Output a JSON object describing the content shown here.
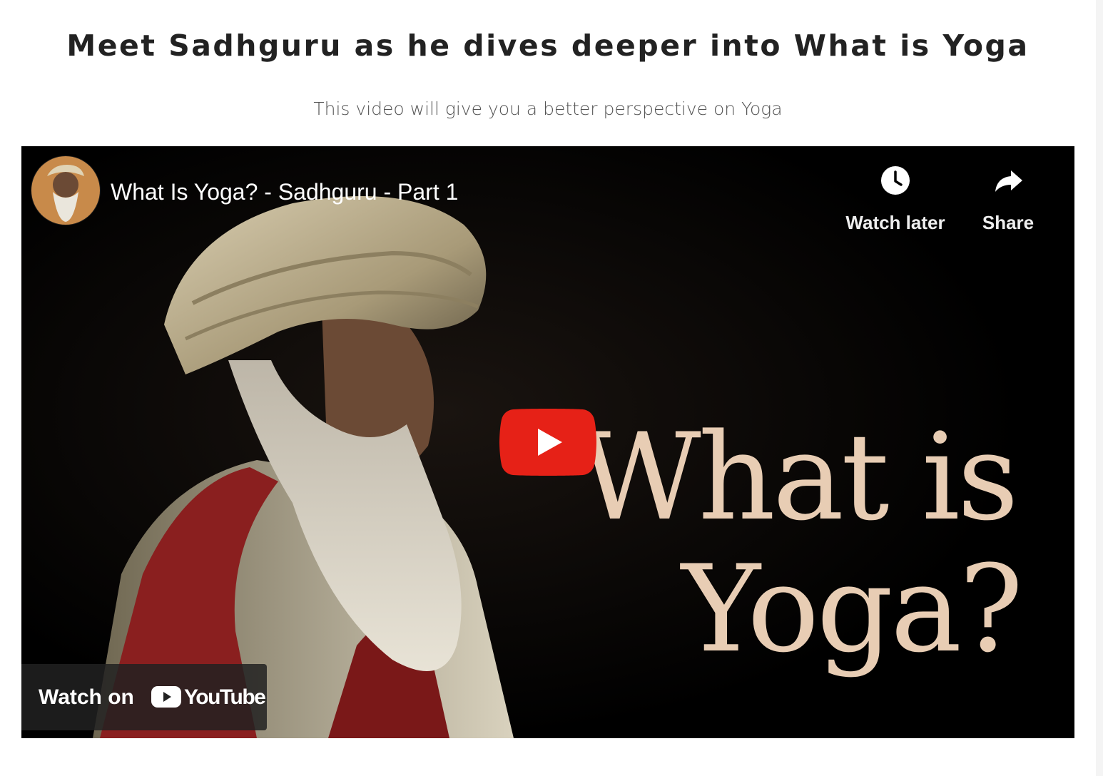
{
  "section": {
    "heading": "Meet Sadhguru as he dives deeper into What is Yoga",
    "subheading": "This video will give you a better perspective on Yoga"
  },
  "video": {
    "title": "What Is Yoga? - Sadhguru - Part 1",
    "watch_later_label": "Watch later",
    "share_label": "Share",
    "thumbnail_text_line1": "What is",
    "thumbnail_text_line2": "Yoga?",
    "watch_on_label": "Watch on",
    "youtube_brand": "YouTube",
    "play_color": "#e62117",
    "icons": {
      "avatar": "channel-avatar",
      "watch_later": "clock-icon",
      "share": "share-arrow-icon",
      "play": "play-icon",
      "youtube": "youtube-logo-icon"
    }
  }
}
